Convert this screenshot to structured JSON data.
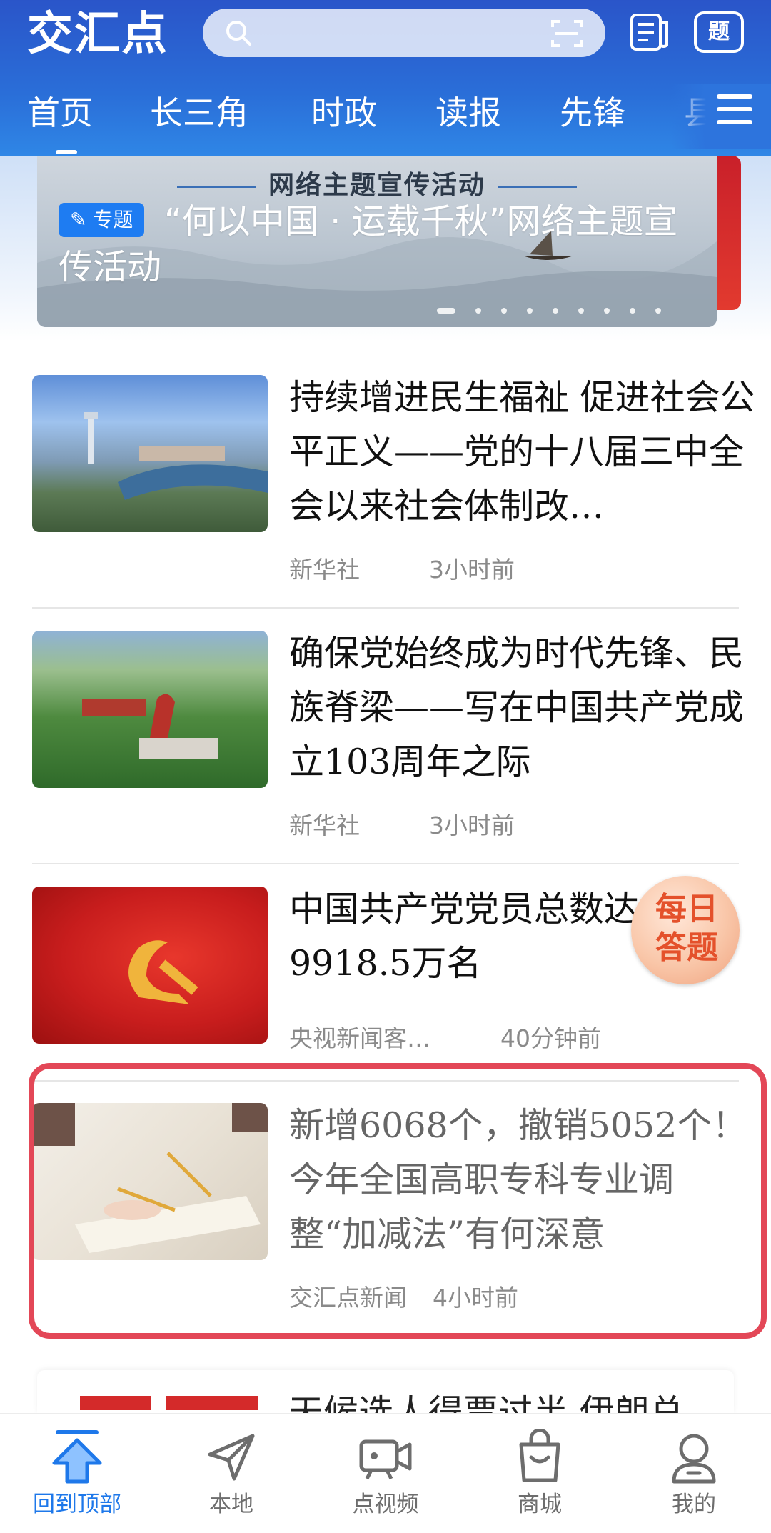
{
  "header": {
    "logo": "交汇点",
    "search": {
      "placeholder": ""
    },
    "quiz_button": "题",
    "tabs": [
      "首页",
      "长三角",
      "时政",
      "读报",
      "先锋",
      "县"
    ]
  },
  "banner": {
    "heading": "网络主题宣传活动",
    "tag": "专题",
    "title": "“何以中国 · 运载千秋”网络主题宣传活动",
    "slide_count": 9,
    "active_slide": 1
  },
  "news": [
    {
      "title": "持续增进民生福祉 促进社会公平正义——党的十八届三中全会以来社会体制改…",
      "source": "新华社",
      "time": "3小时前"
    },
    {
      "title": "确保党始终成为时代先锋、民族脊梁——写在中国共产党成立103周年之际",
      "source": "新华社",
      "time": "3小时前"
    },
    {
      "title": "中国共产党党员总数达9918.5万名",
      "source": "央视新闻客…",
      "time": "40分钟前"
    },
    {
      "title": "新增6068个，撤销5052个！今年全国高职专科专业调整“加减法”有何深意",
      "source": "交汇点新闻",
      "time": "4小时前"
    }
  ],
  "peek_title": "天候选人得票过半 伊朗总",
  "quiz_badge": "每日答题",
  "bottom_nav": [
    "回到顶部",
    "本地",
    "点视频",
    "商城",
    "我的"
  ],
  "colors": {
    "header": "#2a6ed8",
    "accent": "#1e78ea",
    "highlight": "#e34757"
  }
}
